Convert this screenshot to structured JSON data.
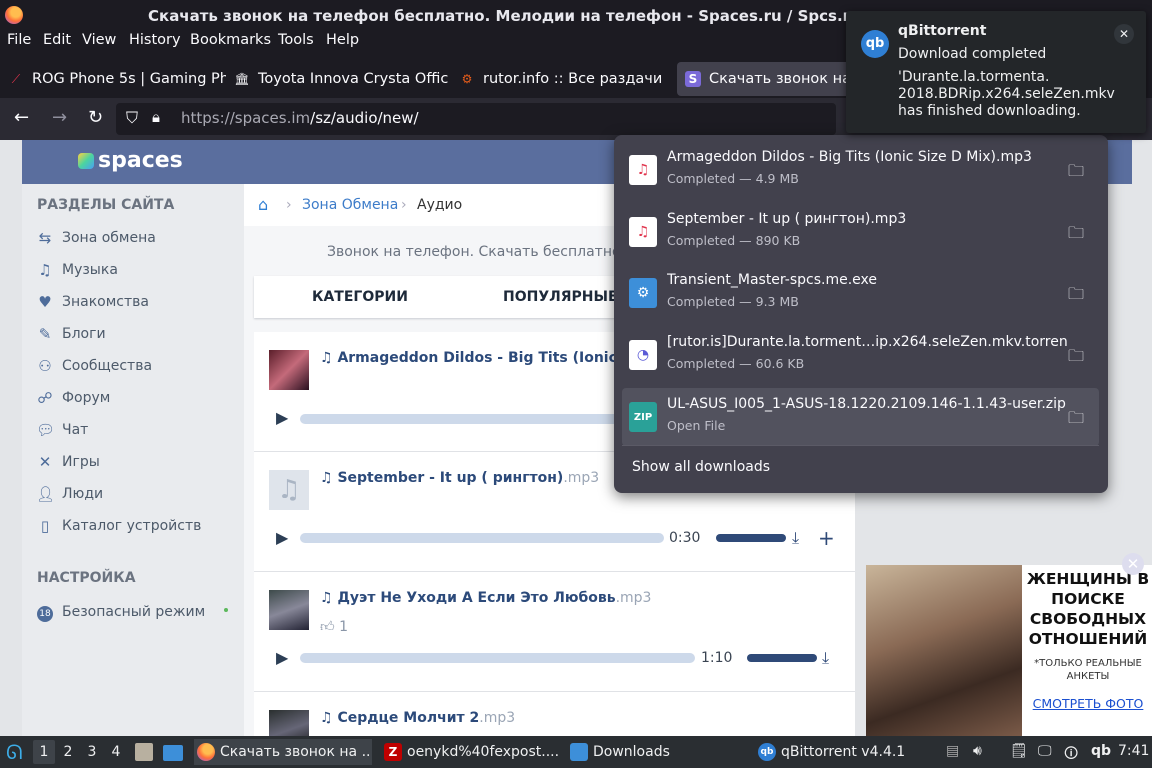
{
  "window": {
    "title": "Скачать звонок на телефон бесплатно. Мелодии на телефон - Spaces.ru / Spcs.m"
  },
  "menu": [
    "File",
    "Edit",
    "View",
    "History",
    "Bookmarks",
    "Tools",
    "Help"
  ],
  "tabs": [
    {
      "label": "ROG Phone 5s | Gaming Ph",
      "icon": "rog-icon"
    },
    {
      "label": "Toyota Innova Crysta Offic",
      "icon": "toyota-icon"
    },
    {
      "label": "rutor.info :: Все раздачи",
      "icon": "rutor-icon"
    },
    {
      "label": "Скачать звонок на те",
      "icon": "spaces-icon"
    }
  ],
  "url": {
    "host": "https://spaces.im",
    "path": "/sz/audio/new/"
  },
  "site": {
    "logo": "spaces",
    "sections_header": "РАЗДЕЛЫ САЙТА",
    "sections": [
      "Зона обмена",
      "Музыка",
      "Знакомства",
      "Блоги",
      "Сообщества",
      "Форум",
      "Чат",
      "Игры",
      "Люди",
      "Каталог устройств"
    ],
    "settings_header": "НАСТРОЙКА",
    "safe_mode": "Безопасный режим",
    "safe_badge": "18",
    "breadcrumb": [
      "Зона Обмена",
      "Аудио"
    ],
    "promo": "Звонок на телефон. Скачать бесплатно мел",
    "categories": [
      "КАТЕГОРИИ",
      "ПОПУЛЯРНЫЕ"
    ],
    "tracks": [
      {
        "title": "Armageddon Dildos - Big Tits (Ionic Size",
        "ext": "",
        "duration": ""
      },
      {
        "title": "September - It up ( рингтон)",
        "ext": ".mp3",
        "duration": "0:30"
      },
      {
        "title": "Дуэт Не Уходи А Если Это Любовь",
        "ext": ".mp3",
        "duration": "1:10",
        "likes": "1"
      },
      {
        "title": "Сердце Молчит 2",
        "ext": ".mp3",
        "duration": ""
      }
    ]
  },
  "downloads": {
    "items": [
      {
        "name": "Armageddon Dildos - Big Tits (Ionic Size D Mix).mp3",
        "status": "Completed — 4.9 MB",
        "icon": "audio-file-icon"
      },
      {
        "name": "September - It up ( рингтон).mp3",
        "status": "Completed — 890 KB",
        "icon": "audio-file-icon"
      },
      {
        "name": "Transient_Master-spcs.me.exe",
        "status": "Completed — 9.3 MB",
        "icon": "gear-file-icon"
      },
      {
        "name": "[rutor.is]Durante.la.torment…ip.x264.seleZen.mkv.torrent",
        "status": "Completed — 60.6 KB",
        "icon": "torrent-file-icon"
      },
      {
        "name": "UL-ASUS_I005_1-ASUS-18.1220.2109.146-1.1.43-user.zip",
        "status": "Open File",
        "icon": "zip-file-icon"
      }
    ],
    "show_all": "Show all downloads"
  },
  "notification": {
    "app": "qBittorrent",
    "heading": "Download completed",
    "body": "'Durante.la.tormenta.\n2018.BDRip.x264.seleZen.mkv\nhas finished downloading."
  },
  "ad": {
    "headline": "ЖЕНЩИНЫ В ПОИСКЕ СВОБОДНЫХ ОТНОШЕНИЙ",
    "note": "*ТОЛЬКО РЕАЛЬНЫЕ АНКЕТЫ",
    "cta": "СМОТРЕТЬ ФОТО"
  },
  "taskbar": {
    "workspaces": [
      "1",
      "2",
      "3",
      "4"
    ],
    "tasks": [
      "Скачать звонок на ...",
      "oenykd%40fexpost....",
      "Downloads",
      "qBittorrent v4.4.1"
    ],
    "clock": "7:41",
    "qb_tray": "qb"
  }
}
